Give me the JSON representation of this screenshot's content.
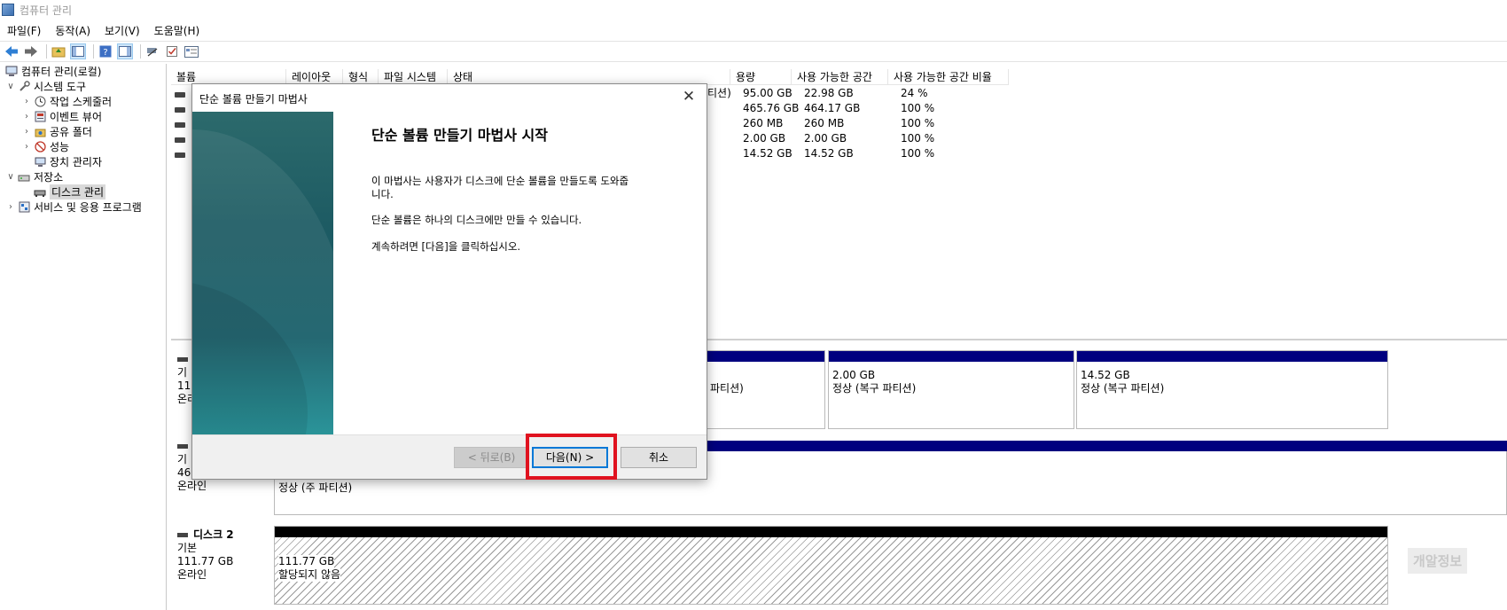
{
  "window": {
    "title": "컴퓨터 관리"
  },
  "menu": [
    "파일(F)",
    "동작(A)",
    "보기(V)",
    "도움말(H)"
  ],
  "tree": {
    "root": "컴퓨터 관리(로컬)",
    "system_tools": "시스템 도구",
    "task_scheduler": "작업 스케줄러",
    "event_viewer": "이벤트 뷰어",
    "shared_folders": "공유 폴더",
    "performance": "성능",
    "device_manager": "장치 관리자",
    "storage": "저장소",
    "disk_management": "디스크 관리",
    "services_apps": "서비스 및 응용 프로그램"
  },
  "volume_list": {
    "columns": [
      "볼륨",
      "레이아웃",
      "형식",
      "파일 시스템",
      "상태",
      "용량",
      "사용 가능한 공간",
      "사용 가능한 공간 비율"
    ],
    "rows": [
      {
        "status_tail": "티션)",
        "capacity": "95.00 GB",
        "free": "22.98 GB",
        "pct": "24 %"
      },
      {
        "status_tail": "",
        "capacity": "465.76 GB",
        "free": "464.17 GB",
        "pct": "100 %"
      },
      {
        "status_tail": "",
        "capacity": "260 MB",
        "free": "260 MB",
        "pct": "100 %"
      },
      {
        "status_tail": "",
        "capacity": "2.00 GB",
        "free": "2.00 GB",
        "pct": "100 %"
      },
      {
        "status_tail": "",
        "capacity": "14.52 GB",
        "free": "14.52 GB",
        "pct": "100 %"
      }
    ]
  },
  "disks": {
    "disk0": {
      "label_lines": [
        "기",
        "111",
        "온리"
      ],
      "partitions": [
        {
          "size": "",
          "status": "파티션)"
        },
        {
          "size": "2.00 GB",
          "status": "정상 (복구 파티션)"
        },
        {
          "size": "14.52 GB",
          "status": "정상 (복구 파티션)"
        }
      ]
    },
    "disk1": {
      "label_lines": [
        "기",
        "46",
        "온라인"
      ],
      "partition": {
        "status": "정상 (주 파티션)"
      }
    },
    "disk2": {
      "name": "디스크 2",
      "type": "기본",
      "size": "111.77 GB",
      "state": "온라인",
      "partition": {
        "size": "111.77 GB",
        "status": "할당되지 않음"
      }
    }
  },
  "dialog": {
    "title": "단순 볼륨 만들기 마법사",
    "heading": "단순 볼륨 만들기 마법사 시작",
    "para1_line1": "이 마법사는 사용자가 디스크에 단순 볼륨을 만들도록 도와줍",
    "para1_line2": "니다.",
    "para2": "단순 볼륨은 하나의 디스크에만 만들 수 있습니다.",
    "para3": "계속하려면 [다음]을 클릭하십시오.",
    "back_button": "< 뒤로(B)",
    "next_button": "다음(N) >",
    "cancel_button": "취소"
  },
  "watermark": "개알정보",
  "colors": {
    "primary_partition_bar": "#00007f",
    "unallocated_bar": "#000000",
    "highlight_box": "#e0121f"
  }
}
